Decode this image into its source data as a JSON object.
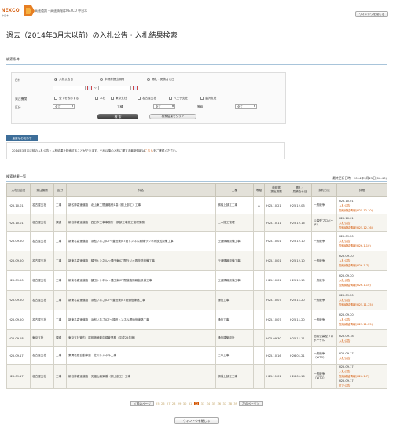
{
  "header": {
    "logo_text": "NEXCO",
    "logo_sub": "中日本",
    "site_title": "高速道路・高速情報はNEXCO 中日本",
    "close_label": "ウィンドウを閉じる"
  },
  "page_title": "過去（2014年3月末以前）の入札公告・入札結果検索",
  "search": {
    "section_title": "検索条件",
    "date_label": "日付",
    "date_options": [
      "入札公告日",
      "申請書提出期限",
      "開札・見積合せ日"
    ],
    "category_label": "発注機関",
    "category_options": [
      "全てを表示する",
      "本社",
      "東京支社",
      "名古屋支社",
      "八王子支社",
      "金沢支社"
    ],
    "type_label": "区分",
    "type_value": "全て",
    "work_label": "工種",
    "work_value": "全て",
    "grade_label": "等級",
    "grade_value": "全て",
    "range_sep": "～",
    "search_btn": "検 索",
    "clear_btn": "検索結果をクリア"
  },
  "notice": {
    "tab": "重要なお知らせ",
    "text": "2014年3月末以前の入札公告・入札結果を検索することができます。それ以降の入札に関する最新情報は",
    "link": "こちら",
    "tail": "をご確認ください。"
  },
  "list": {
    "section_title": "検索結果一覧",
    "meta": "最終更新日時　2014年3月25日(06:43)",
    "headers": [
      "入札公告日",
      "発注機関",
      "区分",
      "件名",
      "工種",
      "等級",
      "申請書\n提出期限",
      "開札・\n見積合せ日",
      "契約方法",
      "詳細"
    ],
    "rows": [
      {
        "date": "H25.10.01",
        "org": "名古屋支社",
        "kind": "工事",
        "title": "新名神高速道路　北山東二間道路他1橋（鋼上部工）工事",
        "work": "鋼橋上部工工事",
        "grade": "A",
        "submit": "H25.10.21",
        "open": "H25.12.03",
        "method": "一般競争",
        "detail": [
          {
            "t": "H25.10.01",
            "o": false
          },
          {
            "t": "入札公告",
            "o": true
          },
          {
            "t": "契約締結情報(H25.12.10)",
            "o": true
          }
        ]
      },
      {
        "date": "H25.10.01",
        "org": "名古屋支社",
        "kind": "調査",
        "title": "新名神高速道路　四日市工事事務所　鋼部工事施工管理業務",
        "work": "土木施工管理",
        "grade": "-",
        "submit": "H25.10.11",
        "open": "H25.12.16",
        "method": "公募型プロポーザル",
        "detail": [
          {
            "t": "H25.10.01",
            "o": false
          },
          {
            "t": "入札公告",
            "o": true
          },
          {
            "t": "契約締結情報(H25.12.16)",
            "o": true
          }
        ]
      },
      {
        "date": "H25.09.20",
        "org": "名古屋支社",
        "kind": "工事",
        "title": "新東名高速道路　浜松いなさJCT～豊田東JCT間トンネル無線ラジオ再放送設備工事",
        "work": "交通情報設備工事",
        "grade": "-",
        "submit": "H25.10.01",
        "open": "H25.12.10",
        "method": "一般競争",
        "detail": [
          {
            "t": "H25.09.20",
            "o": false
          },
          {
            "t": "入札公告",
            "o": true
          },
          {
            "t": "契約締結情報(H26.1.10)",
            "o": true
          }
        ]
      },
      {
        "date": "H25.09.20",
        "org": "名古屋支社",
        "kind": "工事",
        "title": "新東名高速道路　額田トンネル～豊田東JCT間ラジオ再放送設備工事",
        "work": "交通情報設備工事",
        "grade": "-",
        "submit": "H25.10.01",
        "open": "H25.12.10",
        "method": "一般競争",
        "detail": [
          {
            "t": "H25.09.20",
            "o": false
          },
          {
            "t": "入札公告",
            "o": true
          },
          {
            "t": "契約締結情報(H26.1.7)",
            "o": true
          }
        ]
      },
      {
        "date": "H25.09.20",
        "org": "名古屋支社",
        "kind": "工事",
        "title": "新東名高速道路　額田トンネル～豊田東JCT間道路情報板設備工事",
        "work": "交通情報設備工事",
        "grade": "-",
        "submit": "H25.10.01",
        "open": "H25.12.10",
        "method": "一般競争",
        "detail": [
          {
            "t": "H25.09.20",
            "o": false
          },
          {
            "t": "入札公告",
            "o": true
          },
          {
            "t": "契約締結情報(H26.1.10)",
            "o": true
          }
        ]
      },
      {
        "date": "H25.09.20",
        "org": "名古屋支社",
        "kind": "工事",
        "title": "新東名高速道路　浜松いなさJCT～豊田東JCT間通信線路工事",
        "work": "通信工事",
        "grade": "-",
        "submit": "H25.10.07",
        "open": "H25.11.20",
        "method": "一般競争",
        "detail": [
          {
            "t": "H25.09.20",
            "o": false
          },
          {
            "t": "入札公告",
            "o": true
          },
          {
            "t": "契約締結情報(H25.11.25)",
            "o": true
          }
        ]
      },
      {
        "date": "H25.09.20",
        "org": "名古屋支社",
        "kind": "工事",
        "title": "新東名高速道路　浜松いなさJCT～額田トンネル間通信線路工事",
        "work": "通信工事",
        "grade": "-",
        "submit": "H25.10.07",
        "open": "H25.11.20",
        "method": "一般競争",
        "detail": [
          {
            "t": "H25.09.20",
            "o": false
          },
          {
            "t": "入札公告",
            "o": true
          },
          {
            "t": "契約締結情報(H25.11.25)",
            "o": true
          }
        ]
      },
      {
        "date": "H25.09.18",
        "org": "東京支社",
        "kind": "調査",
        "title": "東京支社管内　建設価格動向調査業務（平成25年度）",
        "work": "通信建築設計",
        "grade": "-",
        "submit": "H25.09.30",
        "open": "H25.11.11",
        "method": "簡易公募型プロポーザル",
        "detail": [
          {
            "t": "H25.09.18",
            "o": false
          },
          {
            "t": "入札公告",
            "o": true
          }
        ]
      },
      {
        "date": "H25.09.17",
        "org": "名古屋支社",
        "kind": "工事",
        "title": "東海北陸自動車道　荘川トンネル工事",
        "work": "土木工事",
        "grade": "-",
        "submit": "H25.10.16",
        "open": "H26.01.21",
        "method": "一般競争（WTO）",
        "detail": [
          {
            "t": "H25.09.17",
            "o": false
          },
          {
            "t": "入札公告",
            "o": true
          }
        ]
      },
      {
        "date": "H25.09.17",
        "org": "名古屋支社",
        "kind": "工事",
        "title": "新名神高速道路　安福山高架橋（鋼上部工）工事",
        "work": "鋼橋上部工工事",
        "grade": "-",
        "submit": "H25.11.01",
        "open": "H26.01.16",
        "method": "一般競争（WTO）",
        "detail": [
          {
            "t": "H25.09.17",
            "o": false
          },
          {
            "t": "入札公告",
            "o": true
          },
          {
            "t": "契約締結情報(H26.1.7)",
            "o": true
          },
          {
            "t": "H25.09.17",
            "o": false
          },
          {
            "t": "訂正公告",
            "o": true
          }
        ]
      }
    ]
  },
  "pager": {
    "prev": "＜前のページ",
    "next": "次のページ＞",
    "pages": [
      "25",
      "26",
      "27",
      "28",
      "29",
      "30",
      "31",
      "32",
      "33",
      "34",
      "35",
      "36",
      "37",
      "38",
      "39"
    ],
    "current": "32"
  },
  "footer": {
    "close_label": "ウィンドウを閉じる"
  }
}
